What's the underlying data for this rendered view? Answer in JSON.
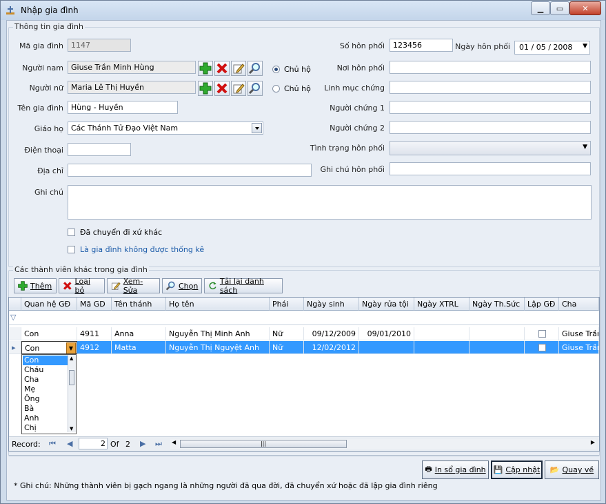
{
  "window": {
    "title": "Nhập gia đình"
  },
  "family_group": {
    "title": "Thông tin gia đình"
  },
  "labels": {
    "ma_gia_dinh": "Mã gia đình",
    "nguoi_nam": "Người nam",
    "nguoi_nu": "Người nữ",
    "ten_gia_dinh": "Tên gia đình",
    "giao_ho": "Giáo họ",
    "dien_thoai": "Điện thoại",
    "dia_chi": "Địa chỉ",
    "ghi_chu": "Ghi chú",
    "so_hon_phoi": "Số hôn phối",
    "ngay_hon_phoi": "Ngày hôn phối",
    "noi_hon_phoi": "Nơi hôn phối",
    "linh_muc_chung": "Linh mục chứng",
    "nguoi_chung_1": "Người chứng 1",
    "nguoi_chung_2": "Người chứng 2",
    "tinh_trang_hon_phoi": "Tình trạng hôn phối",
    "ghi_chu_hon_phoi": "Ghi chú hôn phối",
    "chu_ho": "Chủ hộ"
  },
  "values": {
    "ma_gia_dinh": "1147",
    "nguoi_nam": "Giuse Trần Minh Hùng",
    "nguoi_nu": "Maria Lê Thị Huyền",
    "ten_gia_dinh": "Hùng - Huyền",
    "giao_ho": "Các Thánh Tử Đạo Việt Nam",
    "dien_thoai": "",
    "dia_chi": "",
    "ghi_chu": "",
    "so_hon_phoi": "123456",
    "ngay_hon_phoi": "01 / 05 / 2008",
    "noi_hon_phoi": "",
    "linh_muc_chung": "",
    "nguoi_chung_1": "",
    "nguoi_chung_2": "",
    "tinh_trang_hon_phoi": "",
    "ghi_chu_hon_phoi": ""
  },
  "checkboxes": {
    "da_chuyen": "Đã chuyển đi xứ khác",
    "khong_thong_ke": "Là gia đình không được thống kê"
  },
  "members_group": {
    "title": "Các thành viên khác trong gia đình"
  },
  "toolbar": {
    "them": "Thêm",
    "loai_bo": "Loại bỏ",
    "xem_sua": "Xem-Sửa",
    "chon": "Chọn",
    "tai_lai": "Tải lại danh sách"
  },
  "grid": {
    "columns": [
      "Quan hệ GĐ",
      "Mã GD",
      "Tên thánh",
      "Họ tên",
      "Phái",
      "Ngày sinh",
      "Ngày rửa tội",
      "Ngày XTRL",
      "Ngày Th.Sức",
      "Lập GĐ",
      "Cha"
    ],
    "rows": [
      [
        "Con",
        "4911",
        "Anna",
        "Nguyễn Thị Minh Anh",
        "Nữ",
        "09/12/2009",
        "09/01/2010",
        "",
        "",
        "",
        "Giuse Trần"
      ],
      [
        "Con",
        "4912",
        "Matta",
        "Nguyễn Thị Nguyệt Anh",
        "Nữ",
        "12/02/2012",
        "",
        "",
        "",
        "",
        "Giuse Trần"
      ]
    ],
    "dropdown_options": [
      "Con",
      "Cháu",
      "Cha",
      "Mẹ",
      "Ông",
      "Bà",
      "Anh",
      "Chị"
    ],
    "record_label": "Record:",
    "record_current": "2",
    "record_of": "Of",
    "record_total": "2"
  },
  "buttons": {
    "in_so": "In sổ gia đình",
    "cap_nhat": "Cập nhật",
    "quay_ve": "Quay về"
  },
  "footnote": "* Ghi chú: Những thành viên bị gạch ngang là những người đã qua đời, đã chuyển xứ hoặc đã lập gia đình riêng",
  "colors": {
    "selection": "#3399ff",
    "link_label": "#1a5aa8"
  }
}
